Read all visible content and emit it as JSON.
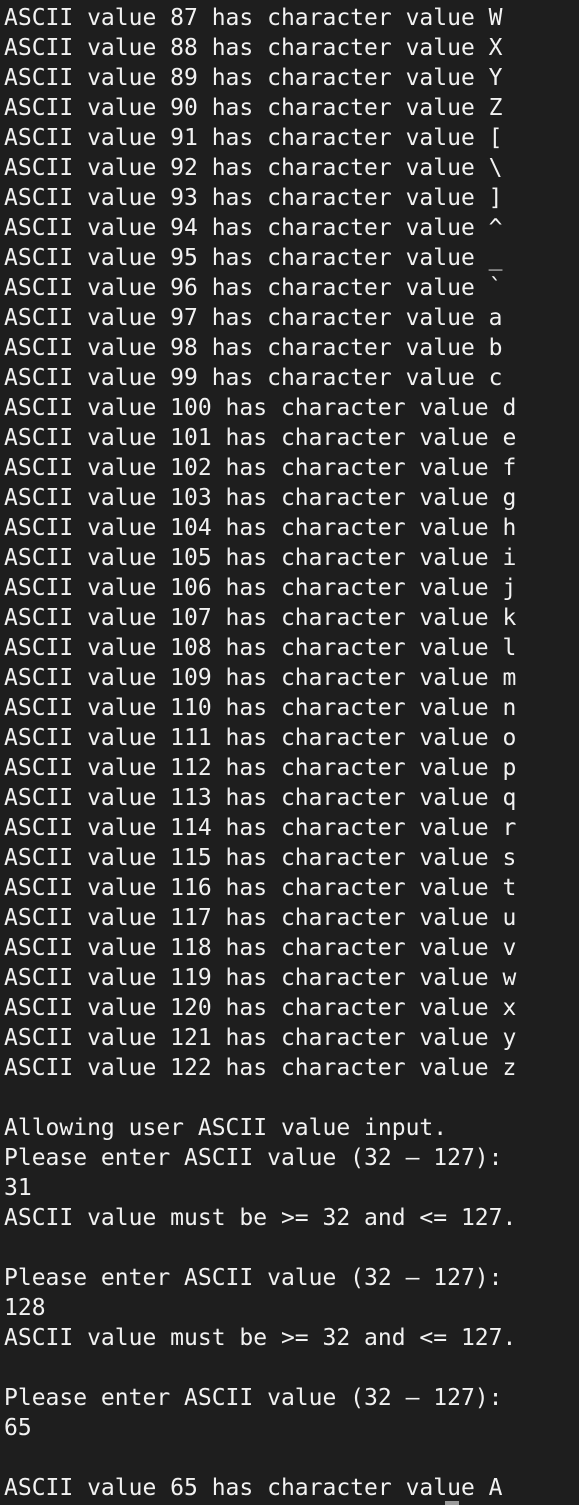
{
  "terminal": {
    "lines": [
      "ASCII value 87 has character value W",
      "ASCII value 88 has character value X",
      "ASCII value 89 has character value Y",
      "ASCII value 90 has character value Z",
      "ASCII value 91 has character value [",
      "ASCII value 92 has character value \\",
      "ASCII value 93 has character value ]",
      "ASCII value 94 has character value ^",
      "ASCII value 95 has character value _",
      "ASCII value 96 has character value `",
      "ASCII value 97 has character value a",
      "ASCII value 98 has character value b",
      "ASCII value 99 has character value c",
      "ASCII value 100 has character value d",
      "ASCII value 101 has character value e",
      "ASCII value 102 has character value f",
      "ASCII value 103 has character value g",
      "ASCII value 104 has character value h",
      "ASCII value 105 has character value i",
      "ASCII value 106 has character value j",
      "ASCII value 107 has character value k",
      "ASCII value 108 has character value l",
      "ASCII value 109 has character value m",
      "ASCII value 110 has character value n",
      "ASCII value 111 has character value o",
      "ASCII value 112 has character value p",
      "ASCII value 113 has character value q",
      "ASCII value 114 has character value r",
      "ASCII value 115 has character value s",
      "ASCII value 116 has character value t",
      "ASCII value 117 has character value u",
      "ASCII value 118 has character value v",
      "ASCII value 119 has character value w",
      "ASCII value 120 has character value x",
      "ASCII value 121 has character value y",
      "ASCII value 122 has character value z",
      "",
      "Allowing user ASCII value input.",
      "Please enter ASCII value (32 – 127):",
      "31",
      "ASCII value must be >= 32 and <= 127.",
      "",
      "Please enter ASCII value (32 – 127):",
      "128",
      "ASCII value must be >= 32 and <= 127.",
      "",
      "Please enter ASCII value (32 – 127):",
      "65",
      "",
      "ASCII value 65 has character value A"
    ],
    "colors": {
      "background": "#1e1e1e",
      "text": "#f2f2f2",
      "cursor": "#9a9a9a"
    }
  }
}
